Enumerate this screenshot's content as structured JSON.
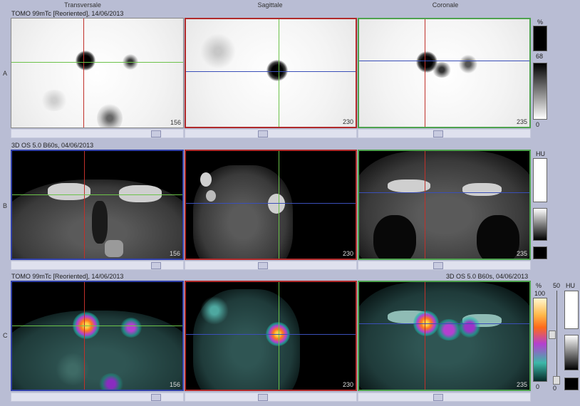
{
  "columns": {
    "transversal": "Transversale",
    "sagittal": "Sagittale",
    "coronal": "Coronale"
  },
  "rows": {
    "a": {
      "letter": "A",
      "caption": "TOMO 99mTc [Reoriented], 14/06/2013"
    },
    "b": {
      "letter": "B",
      "caption": "3D  OS  5.0  B60s, 04/06/2013"
    },
    "c": {
      "letter": "C",
      "caption_left": "TOMO 99mTc [Reoriented], 14/06/2013",
      "caption_right": "3D  OS  5.0  B60s, 04/06/2013"
    }
  },
  "slices": {
    "a1": "156",
    "a2": "230",
    "a3": "235",
    "b1": "156",
    "b2": "230",
    "b3": "235",
    "c1": "156",
    "c2": "230",
    "c3": "235"
  },
  "scales": {
    "a": {
      "unit": "%",
      "top": "68",
      "bottom": "0"
    },
    "b": {
      "unit": "HU"
    },
    "c": {
      "unit_pct": "%",
      "pct_top": "100",
      "pct_bottom": "0",
      "fusion_top": "50",
      "fusion_bottom": "0",
      "unit_hu": "HU"
    }
  },
  "colors": {
    "crosshair_red": "#c0302a",
    "crosshair_green": "#6cc24a",
    "crosshair_blue": "#3a4fb8"
  }
}
